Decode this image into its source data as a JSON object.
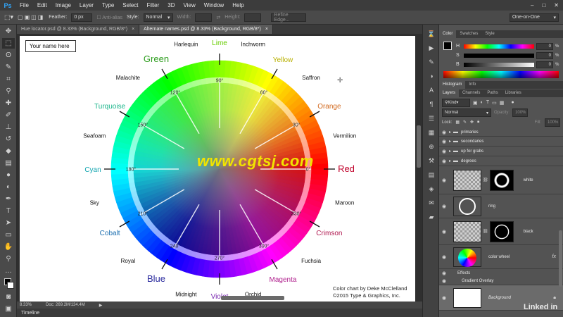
{
  "app": {
    "logo": "Ps",
    "menu": [
      "File",
      "Edit",
      "Image",
      "Layer",
      "Type",
      "Select",
      "Filter",
      "3D",
      "View",
      "Window",
      "Help"
    ]
  },
  "options": {
    "feather_label": "Feather:",
    "feather_value": "0 px",
    "antialias_label": "Anti-alias",
    "style_label": "Style:",
    "style_value": "Normal",
    "width_label": "Width:",
    "height_label": "Height:",
    "refine_edge": "Refine Edge...",
    "workspace": "One-on-One"
  },
  "tabs": [
    {
      "label": "Hue locator.psd @ 8.33% (Background, RGB/8*)",
      "close": "×"
    },
    {
      "label": "Alternate names.psd @ 8.33% (Background, RGB/8*)",
      "close": "×"
    }
  ],
  "canvas": {
    "name_box": "Your name here",
    "watermark": "www.cgtsj.com",
    "credit_1": "Color chart by Deke McClelland",
    "credit_2": "©2015 Type & Graphics, Inc.",
    "degree_marks": [
      "0°",
      "30°",
      "60°",
      "90°",
      "120°",
      "150°",
      "180°",
      "210°",
      "240°",
      "270°",
      "300°",
      "330°"
    ],
    "major_colors": [
      {
        "name": "Red",
        "color": "#c0002a"
      },
      {
        "name": "Orange",
        "color": "#d2691e"
      },
      {
        "name": "Yellow",
        "color": "#b8b000"
      },
      {
        "name": "Lime",
        "color": "#66cc00"
      },
      {
        "name": "Green",
        "color": "#2e9e1f"
      },
      {
        "name": "Turquoise",
        "color": "#19b48a"
      },
      {
        "name": "Cyan",
        "color": "#12a5b0"
      },
      {
        "name": "Cobalt",
        "color": "#1c6fb0"
      },
      {
        "name": "Blue",
        "color": "#2a2a9e"
      },
      {
        "name": "Violet",
        "color": "#7a2ab0"
      },
      {
        "name": "Magenta",
        "color": "#b0218e"
      },
      {
        "name": "Crimson",
        "color": "#b01850"
      }
    ],
    "minor_names": [
      "Vermilion",
      "Saffron",
      "Inchworm",
      "Harlequin",
      "Malachite",
      "Seafoam",
      "Sky",
      "Royal",
      "Midnight",
      "Orchid",
      "Fuchsia",
      "Maroon"
    ]
  },
  "status": {
    "zoom": "8.33%",
    "doc": "Doc: 269.2M/134.4M",
    "arrow": "▶"
  },
  "timeline": {
    "label": "Timeline"
  },
  "color_panel": {
    "tabs": [
      "Color",
      "Swatches",
      "Style"
    ],
    "sliders": [
      {
        "label": "H",
        "value": "0",
        "unit": "%"
      },
      {
        "label": "S",
        "value": "0",
        "unit": "%"
      },
      {
        "label": "B",
        "value": "0",
        "unit": "%"
      }
    ]
  },
  "histogram_panel": {
    "tabs": [
      "Histogram",
      "Info"
    ]
  },
  "layers_panel": {
    "tabs": [
      "Layers",
      "Channels",
      "Paths",
      "Libraries"
    ],
    "filter_label": "Kind",
    "blend_mode": "Normal",
    "opacity_label": "Opacity:",
    "opacity_value": "100%",
    "lock_label": "Lock:",
    "fill_label": "Fill:",
    "fill_value": "100%",
    "groups": [
      "primaries",
      "secondaries",
      "up for grabs",
      "degrees"
    ],
    "layers": [
      {
        "name": "white"
      },
      {
        "name": "ring"
      },
      {
        "name": "black"
      },
      {
        "name": "color wheel",
        "fx": "fx"
      },
      {
        "name": "Background"
      }
    ],
    "effects_label": "Effects",
    "effect_item": "Gradient Overlay"
  },
  "watermark_brand": "Linked in"
}
